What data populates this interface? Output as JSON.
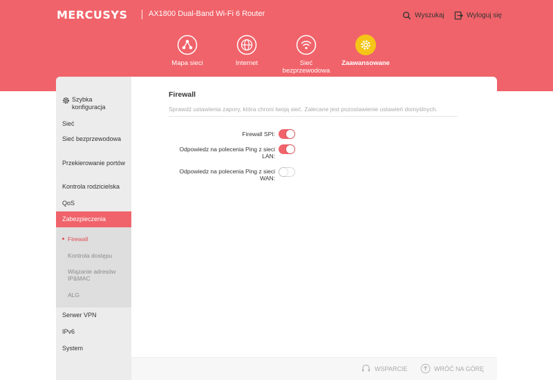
{
  "header": {
    "logo": "MERCUSYS",
    "product": "AX1800 Dual-Band Wi-Fi 6 Router",
    "search_label": "Wyszukaj",
    "logout_label": "Wyloguj się",
    "accent_color": "#f0636a",
    "active_nav_color": "#f5c518"
  },
  "nav": [
    {
      "label": "Mapa sieci",
      "icon": "network-map-icon"
    },
    {
      "label": "Internet",
      "icon": "globe-icon"
    },
    {
      "label": "Sieć bezprzewodowa",
      "icon": "wifi-icon"
    },
    {
      "label": "Zaawansowane",
      "icon": "gear-icon",
      "active": true
    }
  ],
  "sidebar": {
    "items": [
      {
        "label": "Szybka konfiguracja",
        "icon": "gear-icon"
      },
      {
        "label": "Sieć"
      },
      {
        "label": "Sieć bezprzewodowa"
      },
      {
        "label": "Przekierowanie portów"
      },
      {
        "label": "Kontrola rodzicielska"
      },
      {
        "label": "QoS"
      },
      {
        "label": "Zabezpieczenia",
        "active": true
      },
      {
        "label": "Serwer VPN"
      },
      {
        "label": "IPv6"
      },
      {
        "label": "System"
      }
    ],
    "sub_items": [
      {
        "label": "Firewall",
        "active": true
      },
      {
        "label": "Kontrola dostępu"
      },
      {
        "label": "Wiązanie adresów IP&MAC"
      },
      {
        "label": "ALG"
      }
    ]
  },
  "firewall": {
    "title": "Firewall",
    "description": "Sprawdź ustawienia zapory, która chroni twoją sieć. Zalecane jest pozostawienie ustawień domyślnych.",
    "settings": [
      {
        "label": "Firewall SPI:",
        "enabled": true
      },
      {
        "label": "Odpowiedz na polecenia Ping z sieci LAN:",
        "enabled": true
      },
      {
        "label": "Odpowiedz na polecenia Ping z sieci WAN:",
        "enabled": false
      }
    ]
  },
  "footer": {
    "support_label": "WSPARCIE",
    "back_to_top_label": "WRÓĆ NA GÓRĘ"
  }
}
